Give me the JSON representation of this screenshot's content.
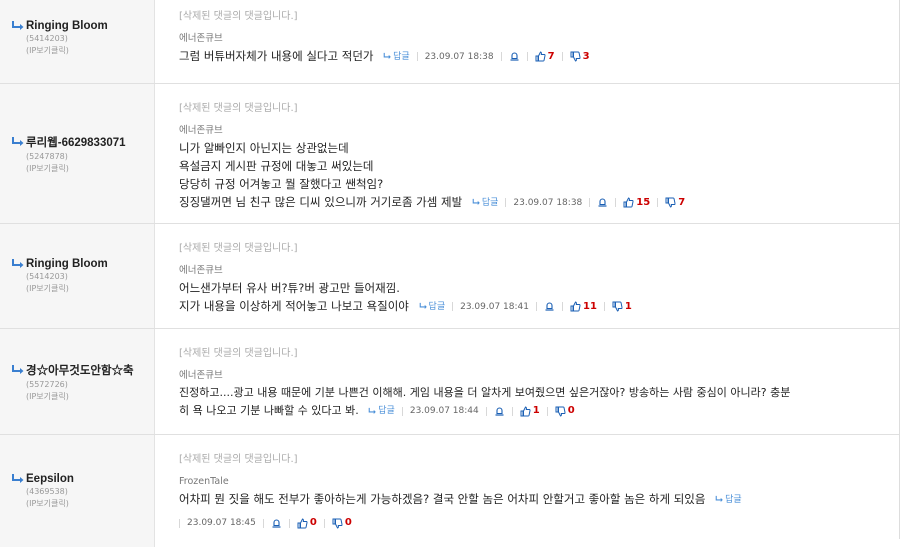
{
  "comments": [
    {
      "nick": "Ringing Bloom",
      "uid": "(5414203)",
      "ip_label": "(IP보기클릭)",
      "deleted_notice": "[삭제된 댓글의 댓글입니다.]",
      "author": "에너존큐브",
      "lines": [
        "그럼 버튜버자체가 내용에 실다고 적던가"
      ],
      "reply_label": "답글",
      "date": "23.09.07 18:38",
      "up": "7",
      "down": "3"
    },
    {
      "nick": "루리웹-6629833071",
      "uid": "(5247878)",
      "ip_label": "(IP보기클릭)",
      "deleted_notice": "[삭제된 댓글의 댓글입니다.]",
      "author": "에너존큐브",
      "lines": [
        "니가 알빠인지 아닌지는 상관없는데",
        "욕설금지 게시판 규정에 대놓고 써있는데",
        "당당히 규정 어겨놓고 뭘 잘했다고 쌘척임?",
        "징징댈꺼면 님 친구 많은 디씨 있으니까 거기로좀 가셈 제발"
      ],
      "reply_label": "답글",
      "date": "23.09.07 18:38",
      "up": "15",
      "down": "7"
    },
    {
      "nick": "Ringing Bloom",
      "uid": "(5414203)",
      "ip_label": "(IP보기클릭)",
      "deleted_notice": "[삭제된 댓글의 댓글입니다.]",
      "author": "에너존큐브",
      "lines": [
        "어느샌가부터 유사 버?튜?버 광고만 들어재낌.",
        "지가 내용을 이상하게 적어놓고 나보고 욕질이야"
      ],
      "reply_label": "답글",
      "date": "23.09.07 18:41",
      "up": "11",
      "down": "1"
    },
    {
      "nick": "경☆아무것도안함☆축",
      "uid": "(5572726)",
      "ip_label": "(IP보기클릭)",
      "deleted_notice": "[삭제된 댓글의 댓글입니다.]",
      "author": "에너존큐브",
      "lines": [
        "진정하고....광고 내용 때문에 기분 나쁜건 이해해. 게임 내용을 더 알차게 보여줬으면 싶은거잖아? 방송하는 사람 중심이 아니라? 충분",
        "히 욕 나오고 기분 나빠할 수 있다고 봐."
      ],
      "reply_label": "답글",
      "date": "23.09.07 18:44",
      "up": "1",
      "down": "0"
    },
    {
      "nick": "Eepsilon",
      "uid": "(4369538)",
      "ip_label": "(IP보기클릭)",
      "deleted_notice": "[삭제된 댓글의 댓글입니다.]",
      "author": "FrozenTale",
      "lines": [
        "어차피 뭔 짓을 해도 전부가 좋아하는게 가능하겠음? 결국 안할 놈은 어차피 안할거고 좋아할 놈은 하게 되있음"
      ],
      "reply_label": "답글",
      "date": "23.09.07 18:45",
      "up": "0",
      "down": "0"
    }
  ],
  "colors": {
    "up": "#1a5fb4",
    "down": "#c00000",
    "reply": "#4a8fd8",
    "nick_arrow": "#3a7fd0"
  },
  "icons": {
    "nick": "reply-arrow-icon",
    "report": "bell-icon",
    "up": "thumbs-up-icon",
    "down": "thumbs-down-icon"
  }
}
